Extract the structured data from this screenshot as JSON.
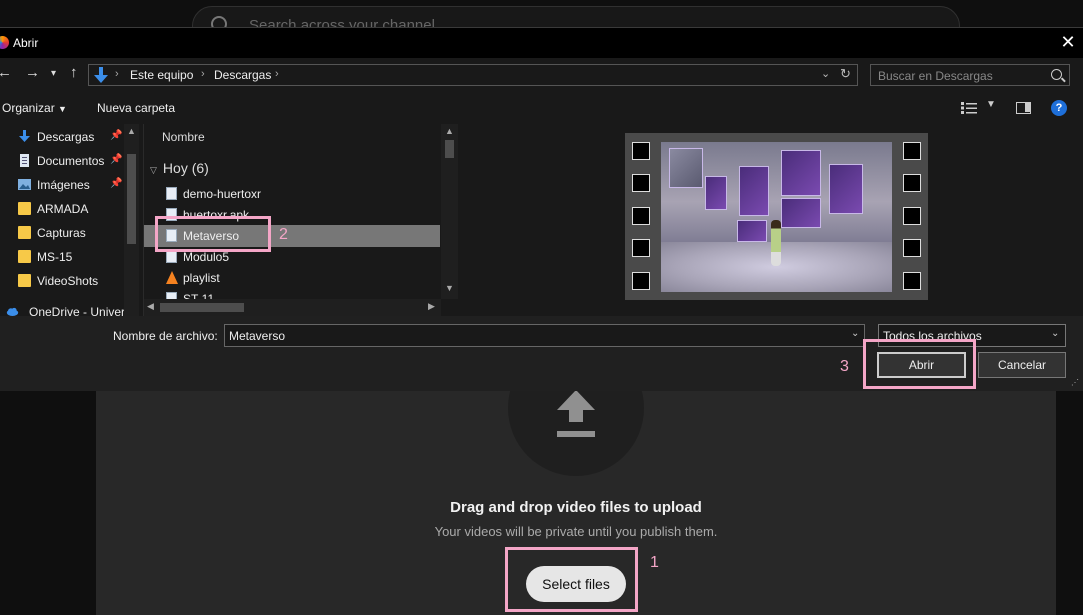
{
  "youtube": {
    "search_placeholder": "Search across your channel",
    "drag_title": "Drag and drop video files to upload",
    "privacy_note": "Your videos will be private until you publish them.",
    "select_files": "Select files"
  },
  "dialog": {
    "title": "Abrir",
    "breadcrumbs": [
      "Este equipo",
      "Descargas"
    ],
    "search_placeholder": "Buscar en Descargas",
    "commands": {
      "organize": "Organizar",
      "new_folder": "Nueva carpeta"
    },
    "nav_items": [
      {
        "label": "Descargas",
        "icon": "download-icon",
        "pinned": true
      },
      {
        "label": "Documentos",
        "icon": "document-icon",
        "pinned": true
      },
      {
        "label": "Imágenes",
        "icon": "image-icon",
        "pinned": true
      },
      {
        "label": "ARMADA",
        "icon": "folder-icon",
        "pinned": false
      },
      {
        "label": "Capturas",
        "icon": "folder-icon",
        "pinned": false
      },
      {
        "label": "MS-15",
        "icon": "folder-icon",
        "pinned": false
      },
      {
        "label": "VideoShots",
        "icon": "folder-icon",
        "pinned": false
      },
      {
        "label": "OneDrive - Univer",
        "icon": "cloud-icon",
        "pinned": false
      }
    ],
    "column_header": "Nombre",
    "group_label": "Hoy (6)",
    "files": [
      {
        "label": "demo-huertoxr",
        "icon": "video-file-icon",
        "selected": false
      },
      {
        "label": "huertoxr.apk",
        "icon": "file-icon",
        "selected": false
      },
      {
        "label": "Metaverso",
        "icon": "video-file-icon",
        "selected": true
      },
      {
        "label": "Modulo5",
        "icon": "video-file-icon",
        "selected": false
      },
      {
        "label": "playlist",
        "icon": "vlc-icon",
        "selected": false
      },
      {
        "label": "ST-11",
        "icon": "file-icon",
        "selected": false
      }
    ],
    "filename_label": "Nombre de archivo:",
    "filename_value": "Metaverso",
    "filter_value": "Todos los archivos",
    "open_button": "Abrir",
    "cancel_button": "Cancelar"
  },
  "annotations": {
    "step1": "1",
    "step2": "2",
    "step3": "3",
    "color": "#f4a6c7"
  },
  "colors": {
    "selection": "#777777",
    "accent_blue": "#1e6fd9",
    "folder": "#f7c948"
  }
}
